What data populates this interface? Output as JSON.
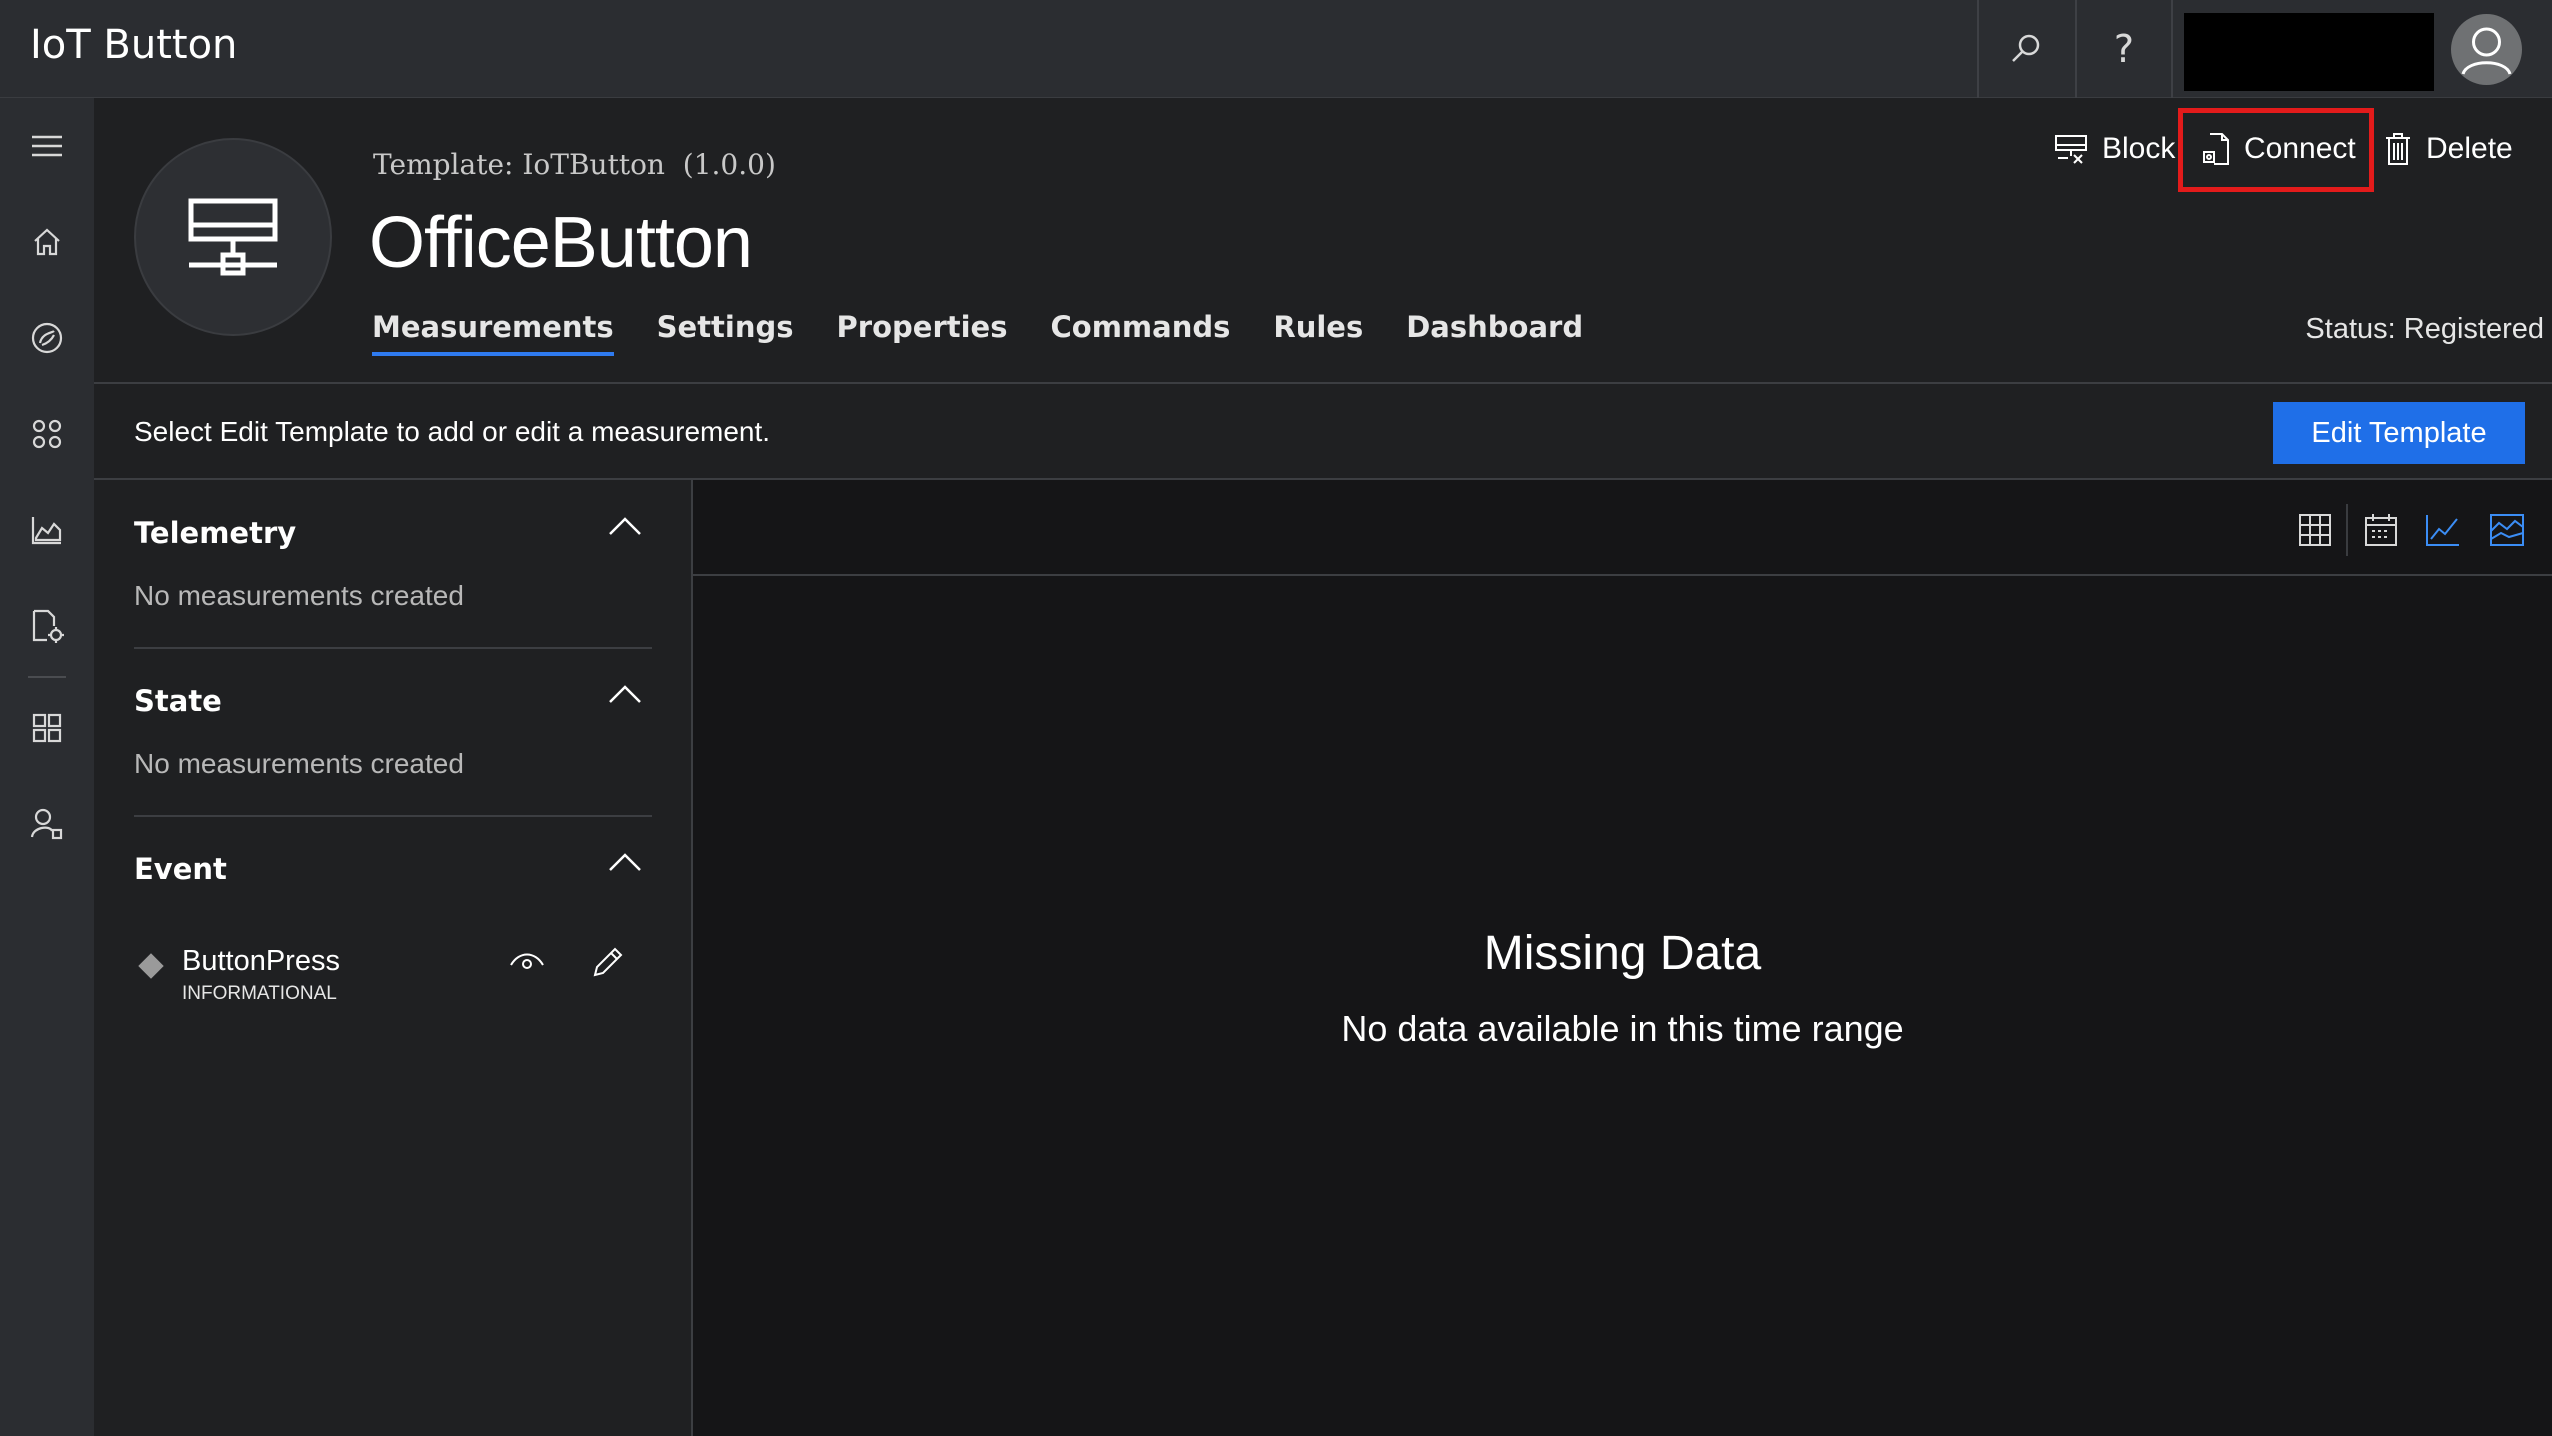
{
  "app": {
    "title": "IoT Button"
  },
  "topbar": {
    "search_icon": "search-icon",
    "help_label": "?",
    "avatar_icon": "user-avatar-icon"
  },
  "sidebar": {
    "items": [
      {
        "icon": "hamburger-menu-icon"
      },
      {
        "icon": "home-icon"
      },
      {
        "icon": "device-explorer-icon"
      },
      {
        "icon": "device-sets-icon"
      },
      {
        "icon": "analytics-icon"
      },
      {
        "icon": "jobs-icon"
      },
      {
        "icon": "application-builder-icon"
      },
      {
        "icon": "administration-icon"
      }
    ]
  },
  "device": {
    "template_prefix": "Template:",
    "template_name": "IoTButton",
    "template_version": "(1.0.0)",
    "name": "OfficeButton",
    "status": "Status: Registered"
  },
  "actions": {
    "block": "Block",
    "connect": "Connect",
    "delete": "Delete"
  },
  "tabs": [
    {
      "label": "Measurements",
      "active": true
    },
    {
      "label": "Settings"
    },
    {
      "label": "Properties"
    },
    {
      "label": "Commands"
    },
    {
      "label": "Rules"
    },
    {
      "label": "Dashboard"
    }
  ],
  "infobar": {
    "text": "Select Edit Template to add or edit a measurement.",
    "edit_button": "Edit Template"
  },
  "sections": [
    {
      "title": "Telemetry",
      "empty": "No measurements created"
    },
    {
      "title": "State",
      "empty": "No measurements created"
    },
    {
      "title": "Event"
    }
  ],
  "event_item": {
    "name": "ButtonPress",
    "severity": "INFORMATIONAL"
  },
  "chart_views": [
    "grid-view-icon",
    "calendar-icon",
    "line-chart-icon",
    "area-chart-icon"
  ],
  "main": {
    "missing_title": "Missing Data",
    "missing_sub": "No data available in this time range"
  },
  "colors": {
    "accent": "#1f6fe8",
    "highlight": "#e31b1b"
  }
}
